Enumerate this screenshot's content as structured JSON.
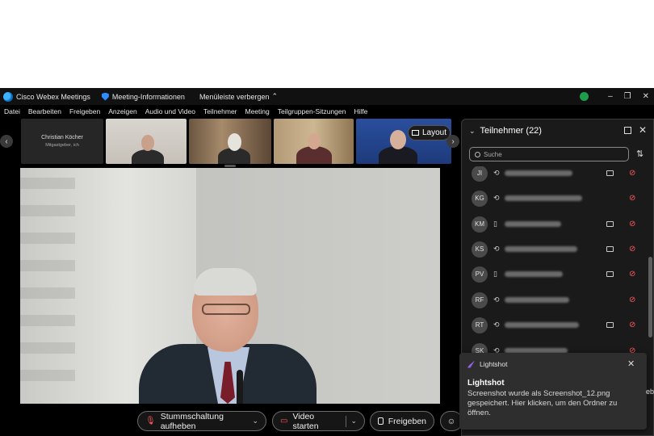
{
  "titlebar": {
    "app_name": "Cisco Webex Meetings",
    "meeting_info": "Meeting-Informationen",
    "hide_menu": "Menüleiste verbergen",
    "minimize": "–",
    "restore": "❐",
    "close": "✕"
  },
  "menu": [
    "Datei",
    "Bearbeiten",
    "Freigeben",
    "Anzeigen",
    "Audio und Video",
    "Teilnehmer",
    "Meeting",
    "Teilgruppen-Sitzungen",
    "Hilfe"
  ],
  "thumbnails": {
    "self_name": "Christian Köcher",
    "self_role": "Mitgastgeber, ich",
    "layout_label": "Layout"
  },
  "controls": {
    "mute_label": "Stummschaltung aufheben",
    "video_label": "Video starten",
    "share_label": "Freigeben"
  },
  "panel": {
    "title": "Teilnehmer (22)",
    "search_placeholder": "Suche",
    "participants": [
      {
        "initials": "JI",
        "device": "phone-sync",
        "camera": true
      },
      {
        "initials": "KG",
        "device": "phone-sync",
        "camera": false
      },
      {
        "initials": "KM",
        "device": "mobile",
        "camera": true
      },
      {
        "initials": "KS",
        "device": "phone-sync",
        "camera": true
      },
      {
        "initials": "PV",
        "device": "mobile",
        "camera": true
      },
      {
        "initials": "RF",
        "device": "phone-sync",
        "camera": false
      },
      {
        "initials": "RT",
        "device": "phone-sync",
        "camera": true
      },
      {
        "initials": "SK",
        "device": "phone-sync",
        "camera": false
      }
    ]
  },
  "toast": {
    "app": "Lightshot",
    "title": "Lightshot",
    "message": "Screenshot wurde als Screenshot_12.png gespeichert. Hier klicken, um den Ordner zu öffnen.",
    "close": "✕"
  },
  "edge_text": "eb",
  "colors": {
    "accent_red": "#ff5a5a",
    "panel_bg": "#1a1a1a",
    "app_bg": "#000000"
  }
}
